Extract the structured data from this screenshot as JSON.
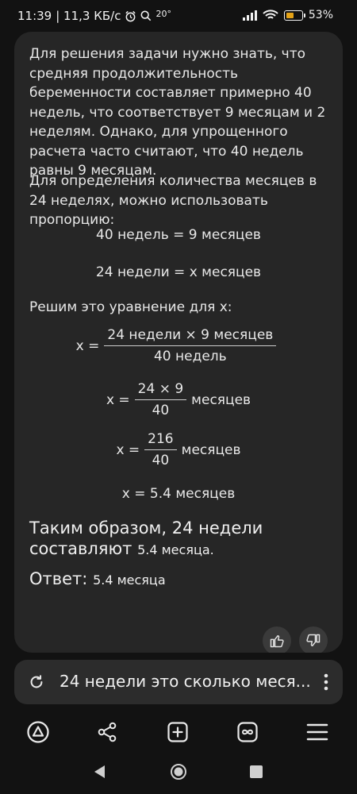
{
  "status_bar": {
    "time": "11:39",
    "network_speed": "| 11,3 КБ/с",
    "temperature": "20°",
    "battery_percent": "53%",
    "battery_level": 0.53,
    "battery_color": "#e5a317"
  },
  "answer": {
    "paragraph_1": "Для решения задачи нужно знать, что средняя продолжительность беременности составляет примерно 40 недель, что соответствует 9 месяцам и 2 неделям. Однако, для упрощенного расчета часто считают, что 40 недель равны 9 месяцам.",
    "paragraph_2": "Для определения количества месяцев в 24 неделях, можно использовать пропорцию:",
    "equation_1": "40 недель = 9 месяцев",
    "equation_2": "24 недели = x месяцев",
    "paragraph_3": "Решим это уравнение для x:",
    "fraction_1": {
      "lhs": "x =",
      "numerator": "24 недели × 9 месяцев",
      "denominator": "40 недель",
      "suffix": ""
    },
    "fraction_2": {
      "lhs": "x =",
      "numerator": "24 × 9",
      "denominator": "40",
      "suffix": "месяцев"
    },
    "fraction_3": {
      "lhs": "x =",
      "numerator": "216",
      "denominator": "40",
      "suffix": "месяцев"
    },
    "equation_3": "x = 5.4 месяцев",
    "conclusion_text": "Таким образом, 24 недели составляют",
    "conclusion_value": "5.4 месяца.",
    "answer_label": "Ответ:",
    "answer_value": "5.4 месяца"
  },
  "feedback": {
    "like_icon": "thumb-up-icon",
    "dislike_icon": "thumb-down-icon"
  },
  "query_bar": {
    "text": "24 недели это сколько меся...",
    "refresh_icon": "refresh-icon",
    "more_icon": "more-vertical-icon"
  },
  "toolbar": {
    "icons": [
      "alice-icon",
      "share-icon",
      "new-tab-icon",
      "tabs-icon",
      "menu-icon"
    ]
  },
  "navbar": {
    "icons": [
      "back-icon",
      "home-icon",
      "recents-icon"
    ]
  },
  "colors": {
    "background": "#121212",
    "card": "#262626",
    "text": "#e8e8e8"
  }
}
